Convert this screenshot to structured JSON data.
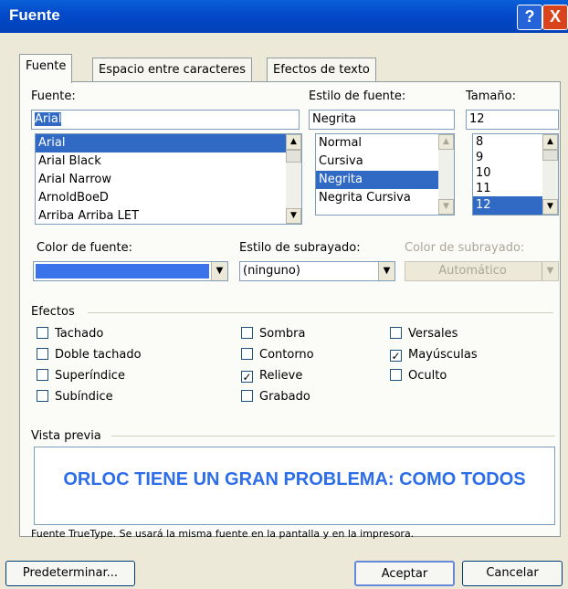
{
  "window": {
    "title": "Fuente",
    "help_icon": "?",
    "close_icon": "X"
  },
  "tabs": [
    "Fuente",
    "Espacio entre caracteres",
    "Efectos de texto"
  ],
  "font": {
    "label": "Fuente:",
    "value": "Arial",
    "list": [
      "Arial",
      "Arial Black",
      "Arial Narrow",
      "ArnoldBoeD",
      "Arriba Arriba LET"
    ],
    "selected": "Arial"
  },
  "style": {
    "label": "Estilo de fuente:",
    "value": "Negrita",
    "list": [
      "Normal",
      "Cursiva",
      "Negrita",
      "Negrita Cursiva"
    ],
    "selected": "Negrita"
  },
  "size": {
    "label": "Tamaño:",
    "value": "12",
    "list": [
      "8",
      "9",
      "10",
      "11",
      "12"
    ],
    "selected": "12"
  },
  "font_color": {
    "label": "Color de fuente:",
    "color": "#3b73ea"
  },
  "underline_style": {
    "label": "Estilo de subrayado:",
    "value": "(ninguno)"
  },
  "underline_color": {
    "label": "Color de subrayado:",
    "value": "Automático"
  },
  "effects": {
    "label": "Efectos",
    "col1": [
      {
        "label": "Tachado",
        "checked": false
      },
      {
        "label": "Doble tachado",
        "checked": false
      },
      {
        "label": "Superíndice",
        "checked": false
      },
      {
        "label": "Subíndice",
        "checked": false
      }
    ],
    "col2": [
      {
        "label": "Sombra",
        "checked": false
      },
      {
        "label": "Contorno",
        "checked": false
      },
      {
        "label": "Relieve",
        "checked": true
      },
      {
        "label": "Grabado",
        "checked": false
      }
    ],
    "col3": [
      {
        "label": "Versales",
        "checked": false
      },
      {
        "label": "Mayúsculas",
        "checked": true
      },
      {
        "label": "Oculto",
        "checked": false
      }
    ]
  },
  "preview": {
    "label": "Vista previa",
    "text": "ORLOC TIENE UN GRAN PROBLEMA: COMO TODOS",
    "info": "Fuente TrueType. Se usará la misma fuente en la pantalla y en la impresora."
  },
  "buttons": {
    "default": "Predeterminar...",
    "ok": "Aceptar",
    "cancel": "Cancelar"
  },
  "colors": {
    "titlebar": "#0349c9",
    "selection": "#316ac5",
    "preview_text": "#2d6ee8"
  }
}
